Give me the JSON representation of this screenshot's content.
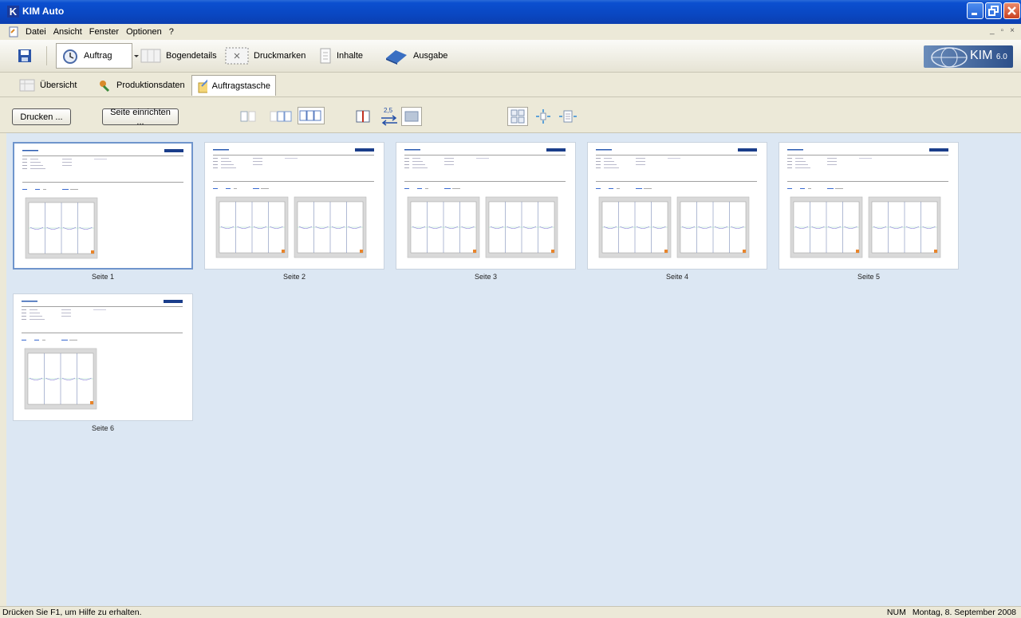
{
  "window": {
    "title": "KIM Auto",
    "app_icon_letter": "K"
  },
  "menu": {
    "items": [
      "Datei",
      "Ansicht",
      "Fenster",
      "Optionen",
      "?"
    ]
  },
  "toolbar": {
    "auftrag": "Auftrag",
    "bogendetails": "Bogendetails",
    "druckmarken": "Druckmarken",
    "inhalte": "Inhalte",
    "ausgabe": "Ausgabe"
  },
  "logo": {
    "text": "KIM",
    "version": "6.0"
  },
  "tabs": {
    "uebersicht": "Übersicht",
    "produktionsdaten": "Produktionsdaten",
    "auftragstasche": "Auftragstasche"
  },
  "actions": {
    "drucken": "Drucken ...",
    "seite_einrichten": "Seite einrichten ..."
  },
  "zoom_label": "2,5",
  "pages": [
    {
      "label": "Seite 1"
    },
    {
      "label": "Seite 2"
    },
    {
      "label": "Seite 3"
    },
    {
      "label": "Seite 4"
    },
    {
      "label": "Seite 5"
    },
    {
      "label": "Seite 6"
    }
  ],
  "status": {
    "help": "Drücken Sie F1, um Hilfe zu erhalten.",
    "num": "NUM",
    "date": "Montag, 8. September 2008"
  },
  "colors": {
    "title_blue": "#0b4fd0",
    "content_bg": "#dce7f3",
    "selection": "#6f95cc"
  }
}
